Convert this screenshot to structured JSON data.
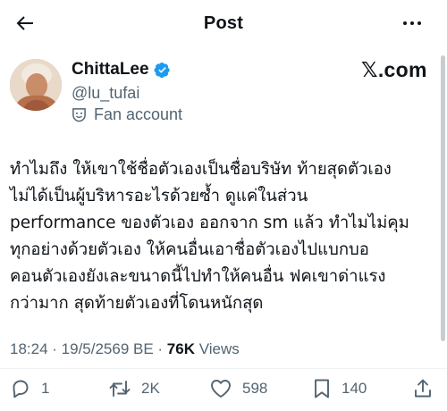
{
  "header": {
    "title": "Post"
  },
  "author": {
    "display_name": "ChittaLee",
    "handle": "@lu_tufai",
    "fan_label": "Fan account",
    "verified": true,
    "badge_color": "#1d9bf0"
  },
  "watermark": "𝕏.com",
  "post": {
    "lines": [
      "ทำไมถึง ให้เขาใช้ชื่อตัวเองเป็นชื่อบริษัท ท้ายสุดตัวเอง",
      "ไม่ได้เป็นผู้บริหารอะไรด้วยซ้ำ ดูแค่ในส่วน",
      "performance ของตัวเอง ออกจาก sm แล้ว ทำไมไม่คุม",
      "ทุกอย่างด้วยตัวเอง ให้คนอื่นเอาชื่อตัวเองไปแบกบอ",
      "คอนตัวเองยังเละขนาดนี้ไปทำให้คนอื่น ฟคเขาด่าแรง",
      "กว่ามาก สุดท้ายตัวเองที่โดนหนักสุด"
    ]
  },
  "meta": {
    "time": "18:24",
    "sep": " · ",
    "date": "19/5/2569 BE",
    "views_count": "76K",
    "views_label": "Views"
  },
  "actions": {
    "replies": "1",
    "reposts": "2K",
    "likes": "598",
    "bookmarks": "140"
  }
}
